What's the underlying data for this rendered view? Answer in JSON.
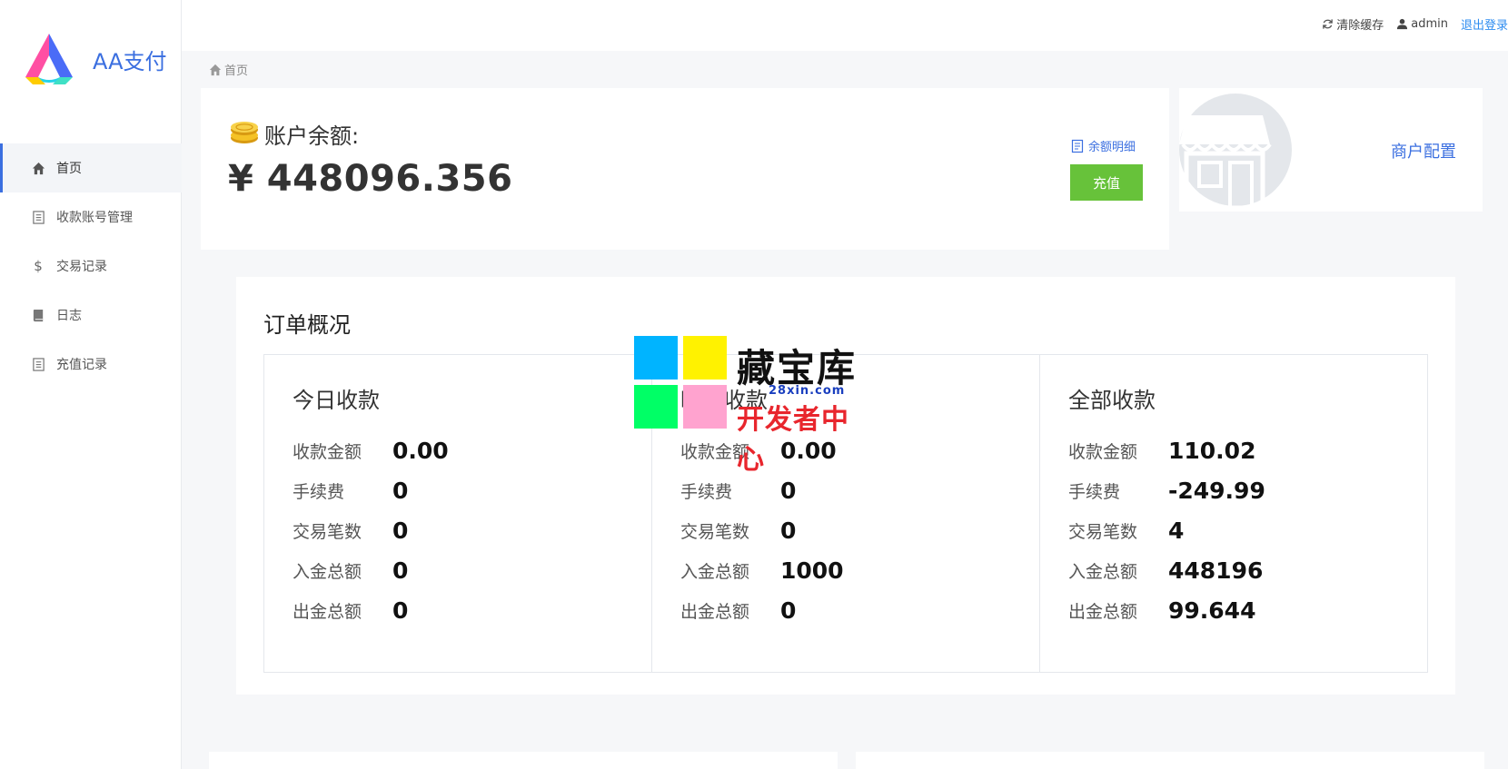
{
  "app": {
    "name": "AA支付"
  },
  "sidebar": {
    "items": [
      {
        "label": "首页",
        "icon": "home-icon",
        "active": true
      },
      {
        "label": "收款账号管理",
        "icon": "list-icon"
      },
      {
        "label": "交易记录",
        "icon": "dollar-icon"
      },
      {
        "label": "日志",
        "icon": "book-icon"
      },
      {
        "label": "充值记录",
        "icon": "list-icon"
      }
    ]
  },
  "topbar": {
    "clear_cache": "清除缓存",
    "user": "admin",
    "logout": "退出登录"
  },
  "breadcrumb": {
    "home": "首页"
  },
  "balance": {
    "label": "账户余额:",
    "value": "¥ 448096.356",
    "detail_link": "余额明细",
    "recharge_button": "充值"
  },
  "merchant": {
    "link": "商户配置"
  },
  "orders": {
    "title": "订单概况",
    "columns": [
      {
        "title": "今日收款",
        "rows": [
          {
            "label": "收款金额",
            "value": "0.00"
          },
          {
            "label": "手续费",
            "value": "0"
          },
          {
            "label": "交易笔数",
            "value": "0"
          },
          {
            "label": "入金总额",
            "value": "0"
          },
          {
            "label": "出金总额",
            "value": "0"
          }
        ]
      },
      {
        "title": "昨日收款",
        "rows": [
          {
            "label": "收款金额",
            "value": "0.00"
          },
          {
            "label": "手续费",
            "value": "0"
          },
          {
            "label": "交易笔数",
            "value": "0"
          },
          {
            "label": "入金总额",
            "value": "1000"
          },
          {
            "label": "出金总额",
            "value": "0"
          }
        ]
      },
      {
        "title": "全部收款",
        "rows": [
          {
            "label": "收款金额",
            "value": "110.02"
          },
          {
            "label": "手续费",
            "value": "-249.99"
          },
          {
            "label": "交易笔数",
            "value": "4"
          },
          {
            "label": "入金总额",
            "value": "448196"
          },
          {
            "label": "出金总额",
            "value": "99.644"
          }
        ]
      }
    ]
  },
  "watermark": {
    "title": "藏宝库",
    "url": "28xin.com",
    "subtitle": "开发者中心"
  },
  "colors": {
    "accent": "#3b6fe0",
    "success": "#67c23a",
    "link": "#2d8cf0",
    "background": "#f6f7f9"
  }
}
